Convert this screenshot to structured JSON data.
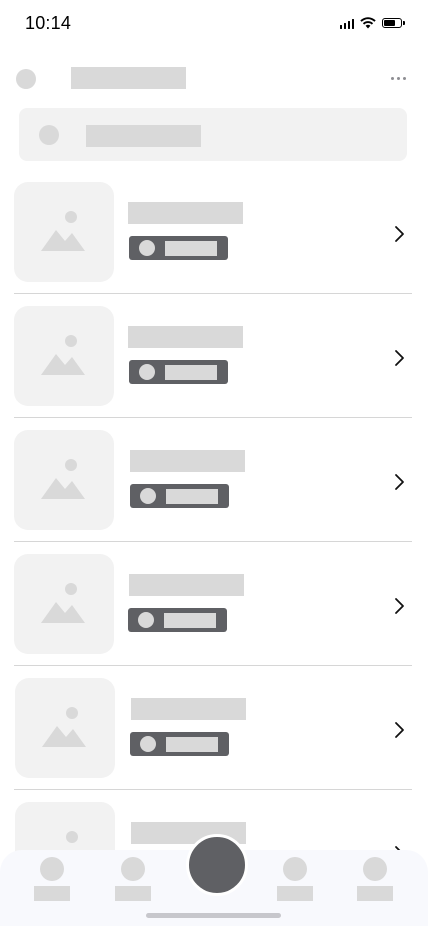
{
  "status_bar": {
    "time": "10:14",
    "icons": [
      "cellular-signal-icon",
      "wifi-icon",
      "battery-icon"
    ]
  },
  "header": {
    "more_icon": "more-horizontal-icon"
  },
  "list": {
    "items": [
      {
        "image_icon": "image-placeholder-icon",
        "chevron_icon": "chevron-right-icon"
      },
      {
        "image_icon": "image-placeholder-icon",
        "chevron_icon": "chevron-right-icon"
      },
      {
        "image_icon": "image-placeholder-icon",
        "chevron_icon": "chevron-right-icon"
      },
      {
        "image_icon": "image-placeholder-icon",
        "chevron_icon": "chevron-right-icon"
      },
      {
        "image_icon": "image-placeholder-icon",
        "chevron_icon": "chevron-right-icon"
      },
      {
        "image_icon": "image-placeholder-icon",
        "chevron_icon": "chevron-right-icon"
      }
    ]
  },
  "tab_bar": {
    "tab_count": 4,
    "has_center_button": true
  },
  "colors": {
    "skeleton": "#d9d9d9",
    "placeholder_bg": "#f2f2f2",
    "badge": "#5f6064",
    "divider": "#d6d6d6",
    "tab_bar_bg": "#f8f9fd",
    "text": "#000000"
  }
}
